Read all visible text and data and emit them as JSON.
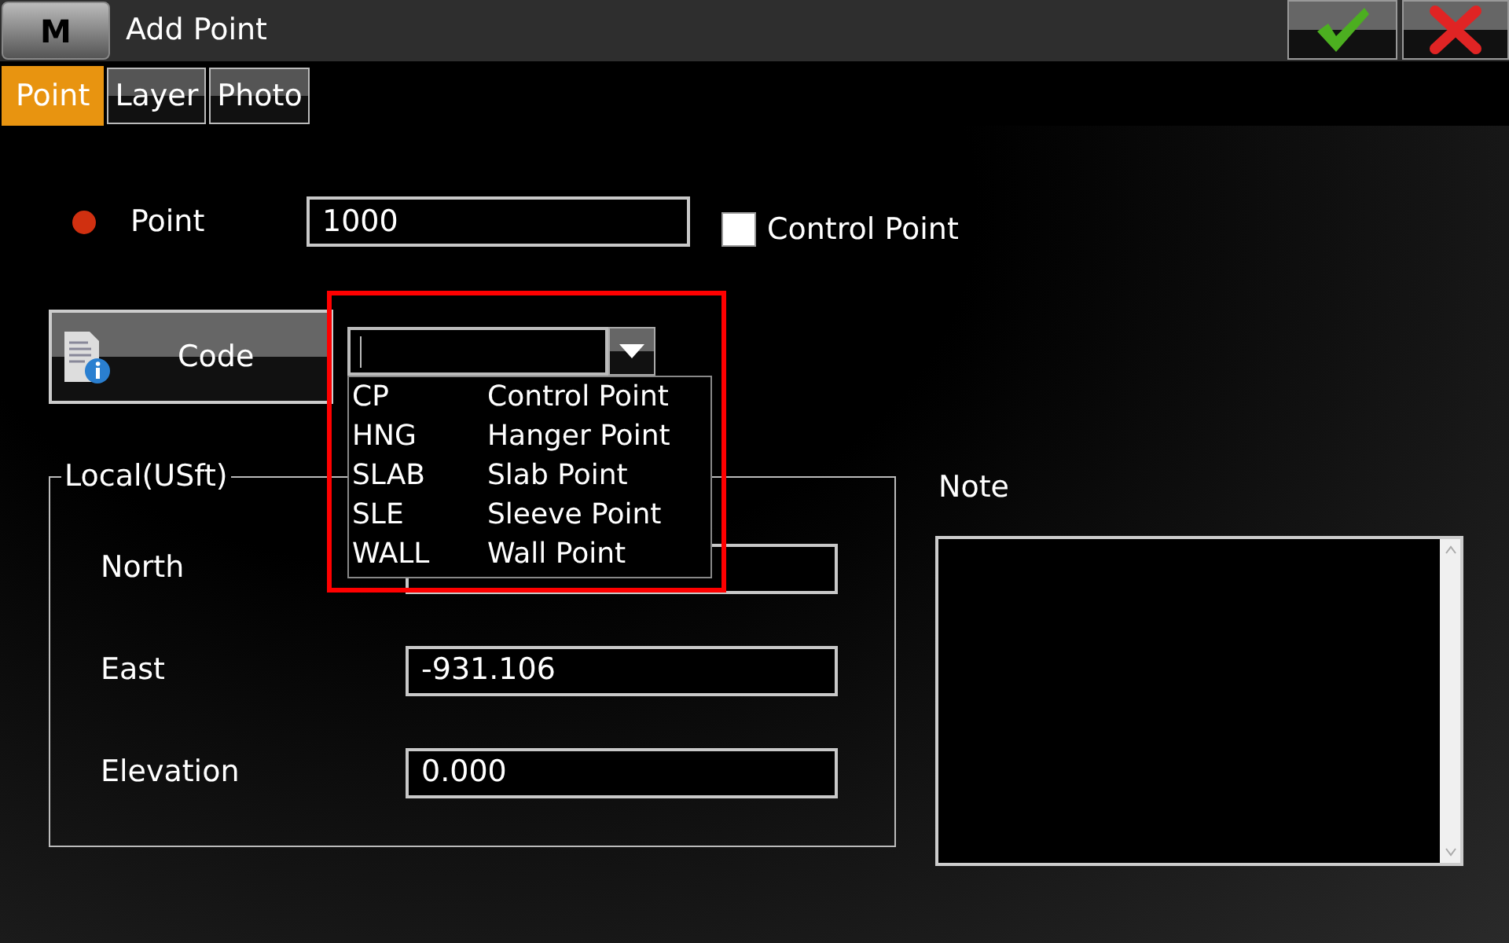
{
  "window": {
    "title": "Add Point",
    "menu_key": "M"
  },
  "tabs": [
    {
      "label": "Point",
      "selected": true
    },
    {
      "label": "Layer",
      "selected": false
    },
    {
      "label": "Photo",
      "selected": false
    }
  ],
  "point": {
    "label": "Point",
    "value": "1000",
    "control_point": {
      "label": "Control Point",
      "checked": false
    }
  },
  "code": {
    "button": "Code",
    "options": [
      {
        "code": "CP",
        "name": "Control Point"
      },
      {
        "code": "HNG",
        "name": "Hanger Point"
      },
      {
        "code": "SLAB",
        "name": "Slab Point"
      },
      {
        "code": "SLE",
        "name": "Sleeve Point"
      },
      {
        "code": "WALL",
        "name": "Wall Point"
      }
    ]
  },
  "local": {
    "title": "Local(USft)",
    "fields": [
      {
        "label": "North"
      },
      {
        "label": "East",
        "value": "-931.106"
      },
      {
        "label": "Elevation",
        "value": "0.000"
      }
    ]
  },
  "note": {
    "label": "Note"
  }
}
